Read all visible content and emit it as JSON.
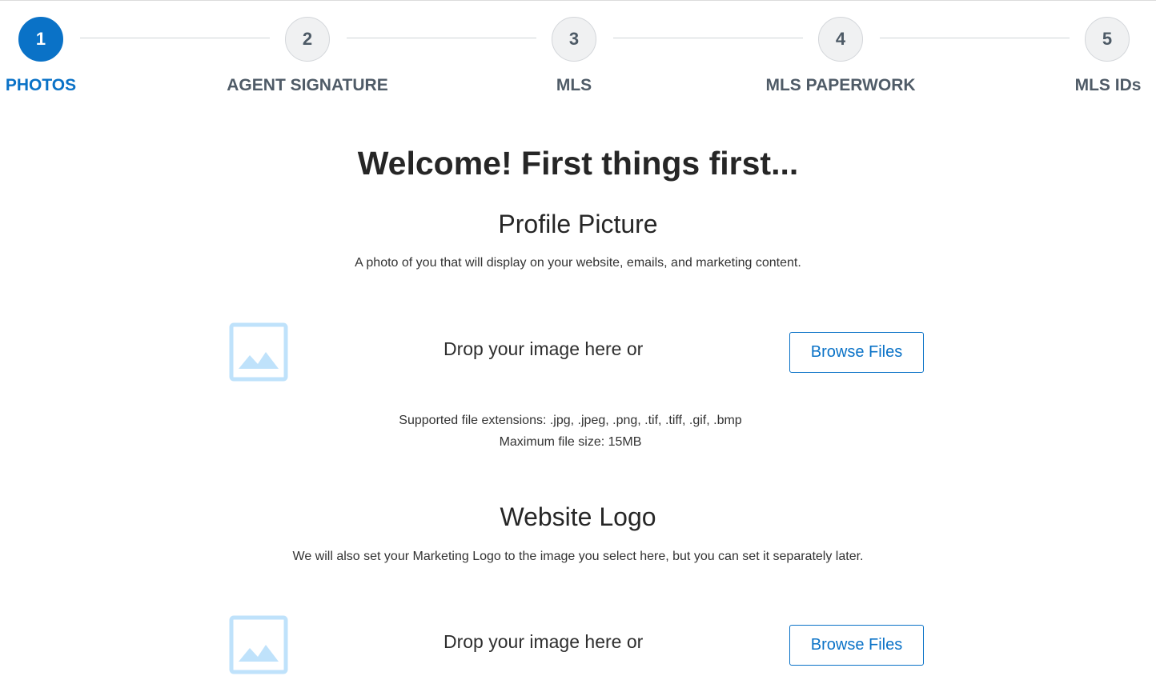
{
  "stepper": {
    "steps": [
      {
        "number": "1",
        "label": "PHOTOS",
        "active": true
      },
      {
        "number": "2",
        "label": "AGENT SIGNATURE",
        "active": false
      },
      {
        "number": "3",
        "label": "MLS",
        "active": false
      },
      {
        "number": "4",
        "label": "MLS PAPERWORK",
        "active": false
      },
      {
        "number": "5",
        "label": "MLS IDs",
        "active": false
      }
    ]
  },
  "welcome_heading": "Welcome! First things first...",
  "profile_picture": {
    "title": "Profile Picture",
    "description": "A photo of you that will display on your website, emails, and marketing content.",
    "drop_text": "Drop your image here or",
    "browse_label": "Browse Files",
    "icon": "image-placeholder-icon",
    "supported_extensions": "Supported file extensions: .jpg, .jpeg, .png, .tif, .tiff, .gif, .bmp",
    "max_size": "Maximum file size: 15MB"
  },
  "website_logo": {
    "title": "Website Logo",
    "description": "We will also set your Marketing Logo to the image you select here, but you can set it separately later.",
    "drop_text": "Drop your image here or",
    "browse_label": "Browse Files",
    "icon": "image-placeholder-icon"
  },
  "colors": {
    "accent": "#0a72c7",
    "step_inactive_bg": "#f0f1f2",
    "step_label_inactive": "#4f5b67",
    "icon_light_blue": "#bfe2fb"
  }
}
